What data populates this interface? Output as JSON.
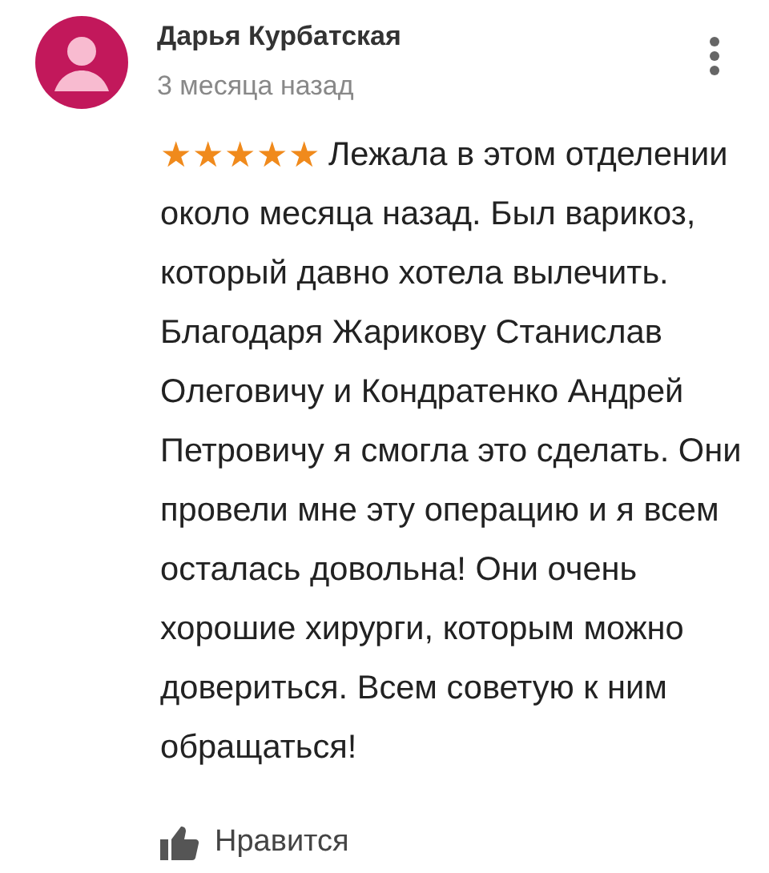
{
  "review": {
    "author": "Дарья Курбатская",
    "time": "3 месяца назад",
    "stars": 5,
    "text": "Лежала в этом отделении около месяца назад. Был варикоз, который давно хотела вылечить. Благодаря Жарикову Станислав Олеговичу и Кондратенко Андрей Петровичу я смогла это сделать. Они провели мне эту операцию и я всем осталась довольна! Они очень хорошие хирурги, которым можно довериться. Всем советую к ним обращаться!",
    "like_label": "Нравится"
  }
}
